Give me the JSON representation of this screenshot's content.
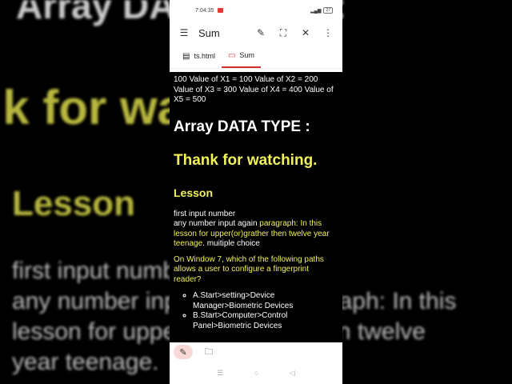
{
  "background": {
    "line1": "Array DATA TYPE :",
    "line2": "Thank for watching.",
    "line3": "Lesson",
    "line4": "first input number",
    "line5": "any number input again paragraph: In this",
    "line6": "lesson for upper(or)grather then twelve",
    "line7": "year teenage."
  },
  "status": {
    "time": "7:04:35",
    "battery": "27"
  },
  "appbar": {
    "title": "Sum",
    "menu_icon": "☰",
    "edit_icon": "✎",
    "expand_icon": "⛶",
    "close_icon": "✕",
    "more_icon": "⋮"
  },
  "tabs": [
    {
      "label": "ts.html",
      "icon": "▤"
    },
    {
      "label": "Sum",
      "icon": "▭"
    }
  ],
  "content": {
    "values_line": "100 Value of X1 = 100 Value of X2 = 200 Value of X3 = 300 Value of X4 = 400 Value of X5 = 500",
    "heading1": "Array DATA TYPE :",
    "heading2": "Thank for watching.",
    "heading3": "Lesson",
    "para_line1": "first input number",
    "para_line2_start": "any number input again ",
    "para_highlight": "paragraph: In this lesson for upper(or)grather then twelve year teenage",
    "para_end": ". muitiple choice",
    "question": "On Window 7, which of the following paths allows a user to configure a fingerprint reader?",
    "options": [
      "A.Start>setting>Device Manager>Biometric Devices",
      "B.Start>Computer>Control Panel>Biometric Devices"
    ]
  },
  "bottombar": {
    "edit_icon": "✎",
    "folder_icon": "🗀"
  },
  "navbar": {
    "recents": "☰",
    "home": "○",
    "back": "◁"
  },
  "colors": {
    "accent": "#d32f2f",
    "highlight": "#f2f25a"
  }
}
